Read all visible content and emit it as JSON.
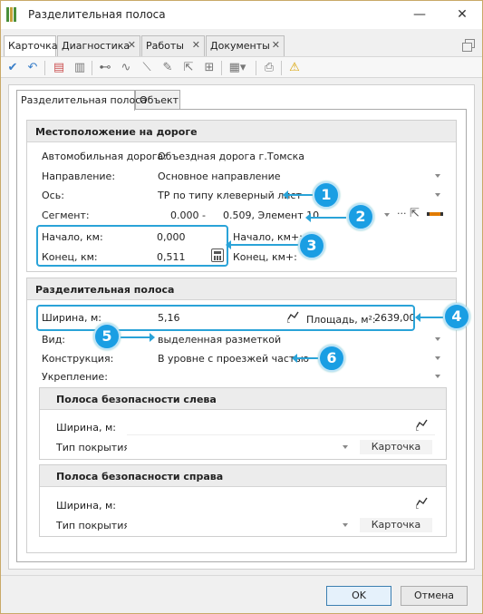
{
  "window": {
    "title": "Разделительная полоса",
    "minimize_glyph": "—",
    "close_glyph": "✕"
  },
  "doc_tabs": [
    {
      "label": "Карточка",
      "closable": false
    },
    {
      "label": "Диагностика",
      "closable": true
    },
    {
      "label": "Работы",
      "closable": true
    },
    {
      "label": "Документы",
      "closable": true
    }
  ],
  "toolbar": {
    "icons": [
      "save-check-icon",
      "undo-icon",
      "report-icon",
      "clipboard-icon",
      "segment-tool-icon",
      "curve-tool-icon",
      "line-tool-icon",
      "pencil-tool-icon",
      "cursor-tool-icon",
      "measure-tool-icon",
      "grid-dropdown-icon",
      "print-icon",
      "warning-icon"
    ]
  },
  "inner_tabs": [
    "Разделительная полоса",
    "Объект"
  ],
  "location": {
    "header": "Местоположение на дороге",
    "road_label": "Автомобильная дорога:",
    "road_value": "Объездная дорога г.Томска",
    "direction_label": "Направление:",
    "direction_value": "Основное направление",
    "axis_label": "Ось:",
    "axis_value": "ТР по типу клеверный лист",
    "segment_label": "Сегмент:",
    "segment_start": "0.000 -",
    "segment_end": "0.509, Элемент 10",
    "segment_more": "···",
    "start_km_label": "Начало, км:",
    "start_km_value": "0,000",
    "end_km_label": "Конец, км:",
    "end_km_value": "0,511",
    "start_kmplus_label": "Начало, км+:",
    "end_kmplus_label": "Конец, км+:"
  },
  "strip": {
    "header": "Разделительная полоса",
    "width_label": "Ширина, м:",
    "width_value": "5,16",
    "area_label": "Площадь, м²:",
    "area_value": "2639,00",
    "type_label": "Вид:",
    "type_value": "выделенная разметкой",
    "construction_label": "Конструкция:",
    "construction_value": "В уровне с проезжей частью",
    "reinforcement_label": "Укрепление:",
    "reinforcement_value": ""
  },
  "safety_left": {
    "header": "Полоса безопасности слева",
    "width_label": "Ширина, м:",
    "cover_label": "Тип покрытия:",
    "card_button": "Карточка"
  },
  "safety_right": {
    "header": "Полоса безопасности справа",
    "width_label": "Ширина, м:",
    "cover_label": "Тип покрытия:",
    "card_button": "Карточка"
  },
  "callouts": [
    "1",
    "2",
    "3",
    "4",
    "5",
    "6"
  ],
  "footer": {
    "ok": "OK",
    "cancel": "Отмена"
  },
  "colors": {
    "accent": "#1a9ee3",
    "highlight": "#2aa3d8",
    "frame": "#c9a968"
  }
}
